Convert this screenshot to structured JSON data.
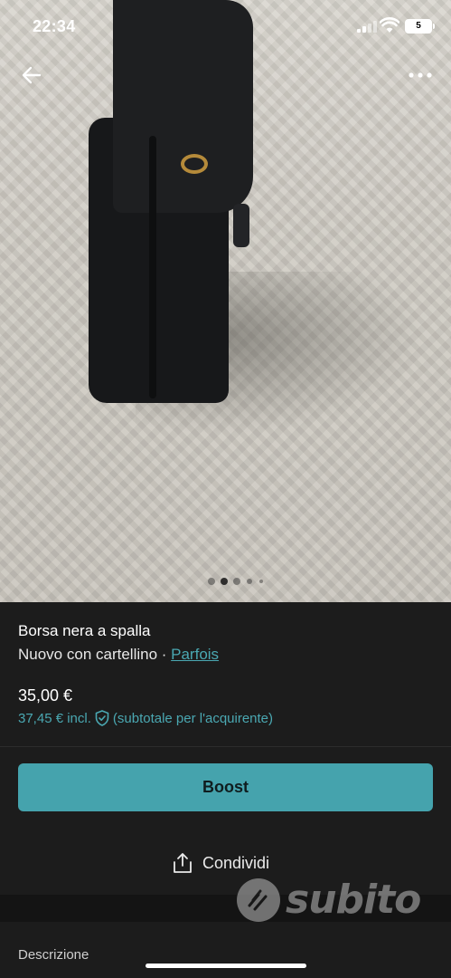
{
  "status_bar": {
    "time": "22:34",
    "battery": "5"
  },
  "photo": {
    "carousel_dots": 5,
    "active_dot": 2
  },
  "item": {
    "title": "Borsa nera a spalla",
    "condition": "Nuovo con cartellino",
    "separator": " · ",
    "brand": "Parfois",
    "price": "35,00 €",
    "price_incl": "37,45 € incl.",
    "price_note": "(subtotale per l'acquirente)"
  },
  "actions": {
    "boost_label": "Boost",
    "share_label": "Condividi"
  },
  "description": {
    "label": "Descrizione"
  },
  "watermark": {
    "text": "subito"
  },
  "colors": {
    "accent": "#45a3ad",
    "link": "#4aa8b2",
    "background": "#1c1c1c"
  },
  "icons": {
    "back": "arrow-left-icon",
    "more": "more-horizontal-icon",
    "shield": "shield-check-icon",
    "share": "share-icon"
  }
}
